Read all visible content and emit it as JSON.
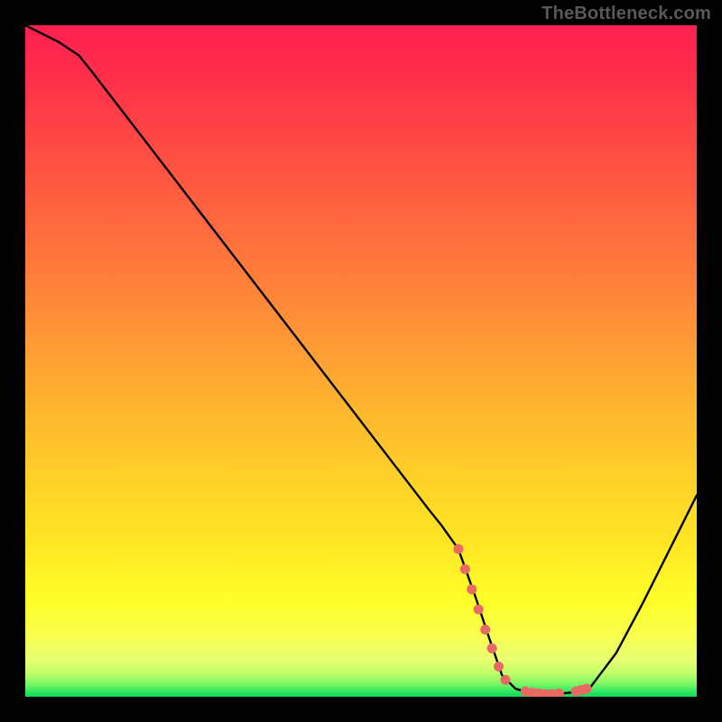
{
  "watermark": "TheBottleneck.com",
  "chart_data": {
    "type": "line",
    "title": "",
    "xlabel": "",
    "ylabel": "",
    "xlim": [
      0,
      100
    ],
    "ylim": [
      0,
      100
    ],
    "x": [
      0,
      2,
      5,
      8,
      10,
      15,
      20,
      25,
      30,
      35,
      40,
      45,
      50,
      55,
      60,
      62,
      64.5,
      67,
      69,
      71,
      73,
      75,
      77,
      79,
      80,
      82,
      84,
      88,
      92,
      96,
      100
    ],
    "values": [
      100,
      99,
      97.5,
      95.5,
      93,
      86.5,
      80,
      73.5,
      67,
      60.5,
      54,
      47.5,
      41,
      34.5,
      28,
      25.5,
      22,
      15,
      9,
      3.2,
      1.2,
      0.6,
      0.4,
      0.4,
      0.5,
      0.7,
      1.2,
      6.5,
      14,
      22,
      30
    ],
    "markers": {
      "x": [
        64.5,
        65.5,
        66.5,
        67.5,
        68.5,
        69.5,
        70.5,
        71.5,
        74.5,
        75.5,
        76.5,
        77.5,
        78.5,
        79.5,
        82,
        82.8,
        83.6
      ],
      "y": [
        22,
        19,
        16,
        13,
        10,
        7.2,
        4.5,
        2.5,
        0.8,
        0.6,
        0.5,
        0.4,
        0.4,
        0.5,
        0.8,
        1.0,
        1.2
      ]
    },
    "gradient_stops": [
      {
        "offset": 0.0,
        "color": "#ff2050"
      },
      {
        "offset": 0.08,
        "color": "#ff2f4a"
      },
      {
        "offset": 0.18,
        "color": "#ff4a44"
      },
      {
        "offset": 0.3,
        "color": "#ff6a3e"
      },
      {
        "offset": 0.42,
        "color": "#ff8a38"
      },
      {
        "offset": 0.55,
        "color": "#ffb030"
      },
      {
        "offset": 0.68,
        "color": "#ffd228"
      },
      {
        "offset": 0.78,
        "color": "#ffe824"
      },
      {
        "offset": 0.86,
        "color": "#feff28"
      },
      {
        "offset": 0.91,
        "color": "#f8ff50"
      },
      {
        "offset": 0.945,
        "color": "#e8ff70"
      },
      {
        "offset": 0.965,
        "color": "#c0ff68"
      },
      {
        "offset": 0.98,
        "color": "#80f864"
      },
      {
        "offset": 0.992,
        "color": "#30e860"
      },
      {
        "offset": 1.0,
        "color": "#10d858"
      }
    ]
  }
}
